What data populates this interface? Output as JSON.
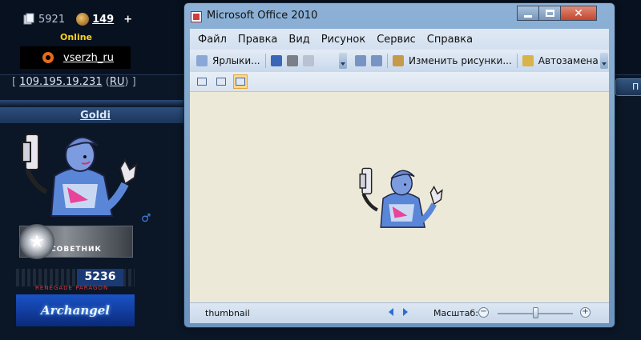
{
  "forum": {
    "posts_count": "5921",
    "reputation": "149",
    "reputation_plus": "+",
    "status": "Online",
    "skype_name": "vserzh_ru",
    "ip_open": "[",
    "ip": "109.195.19.231",
    "ip_country_open": " (",
    "ip_country": "RU",
    "ip_close": ") ]",
    "username": "Goldi",
    "right_tab": "П",
    "rank_title": "СОВЕТНИК",
    "score": "5236",
    "score_caption": "RENEGADE PARAGON",
    "group_badge": "Archangel"
  },
  "window": {
    "title": "Microsoft Office 2010",
    "menu": [
      "Файл",
      "Правка",
      "Вид",
      "Рисунок",
      "Сервис",
      "Справка"
    ],
    "menu_hotkeys": [
      "Ф",
      "П",
      "В",
      "Р",
      "С",
      "С"
    ],
    "toolbar": {
      "shortcuts": "Ярлыки...",
      "edit_pictures": "Изменить рисунки...",
      "autocorrect": "Автозамена"
    },
    "status_text": "thumbnail",
    "zoom_label": "Масштаб:",
    "zoom_out": "−",
    "zoom_in": "+",
    "zoom_level": 0.5
  },
  "colors": {
    "page_bg": "#0b1626",
    "link": "#ffffff",
    "online": "#ffd21e",
    "canvas": "#ece9d8",
    "active_view": "#fbd88e"
  }
}
